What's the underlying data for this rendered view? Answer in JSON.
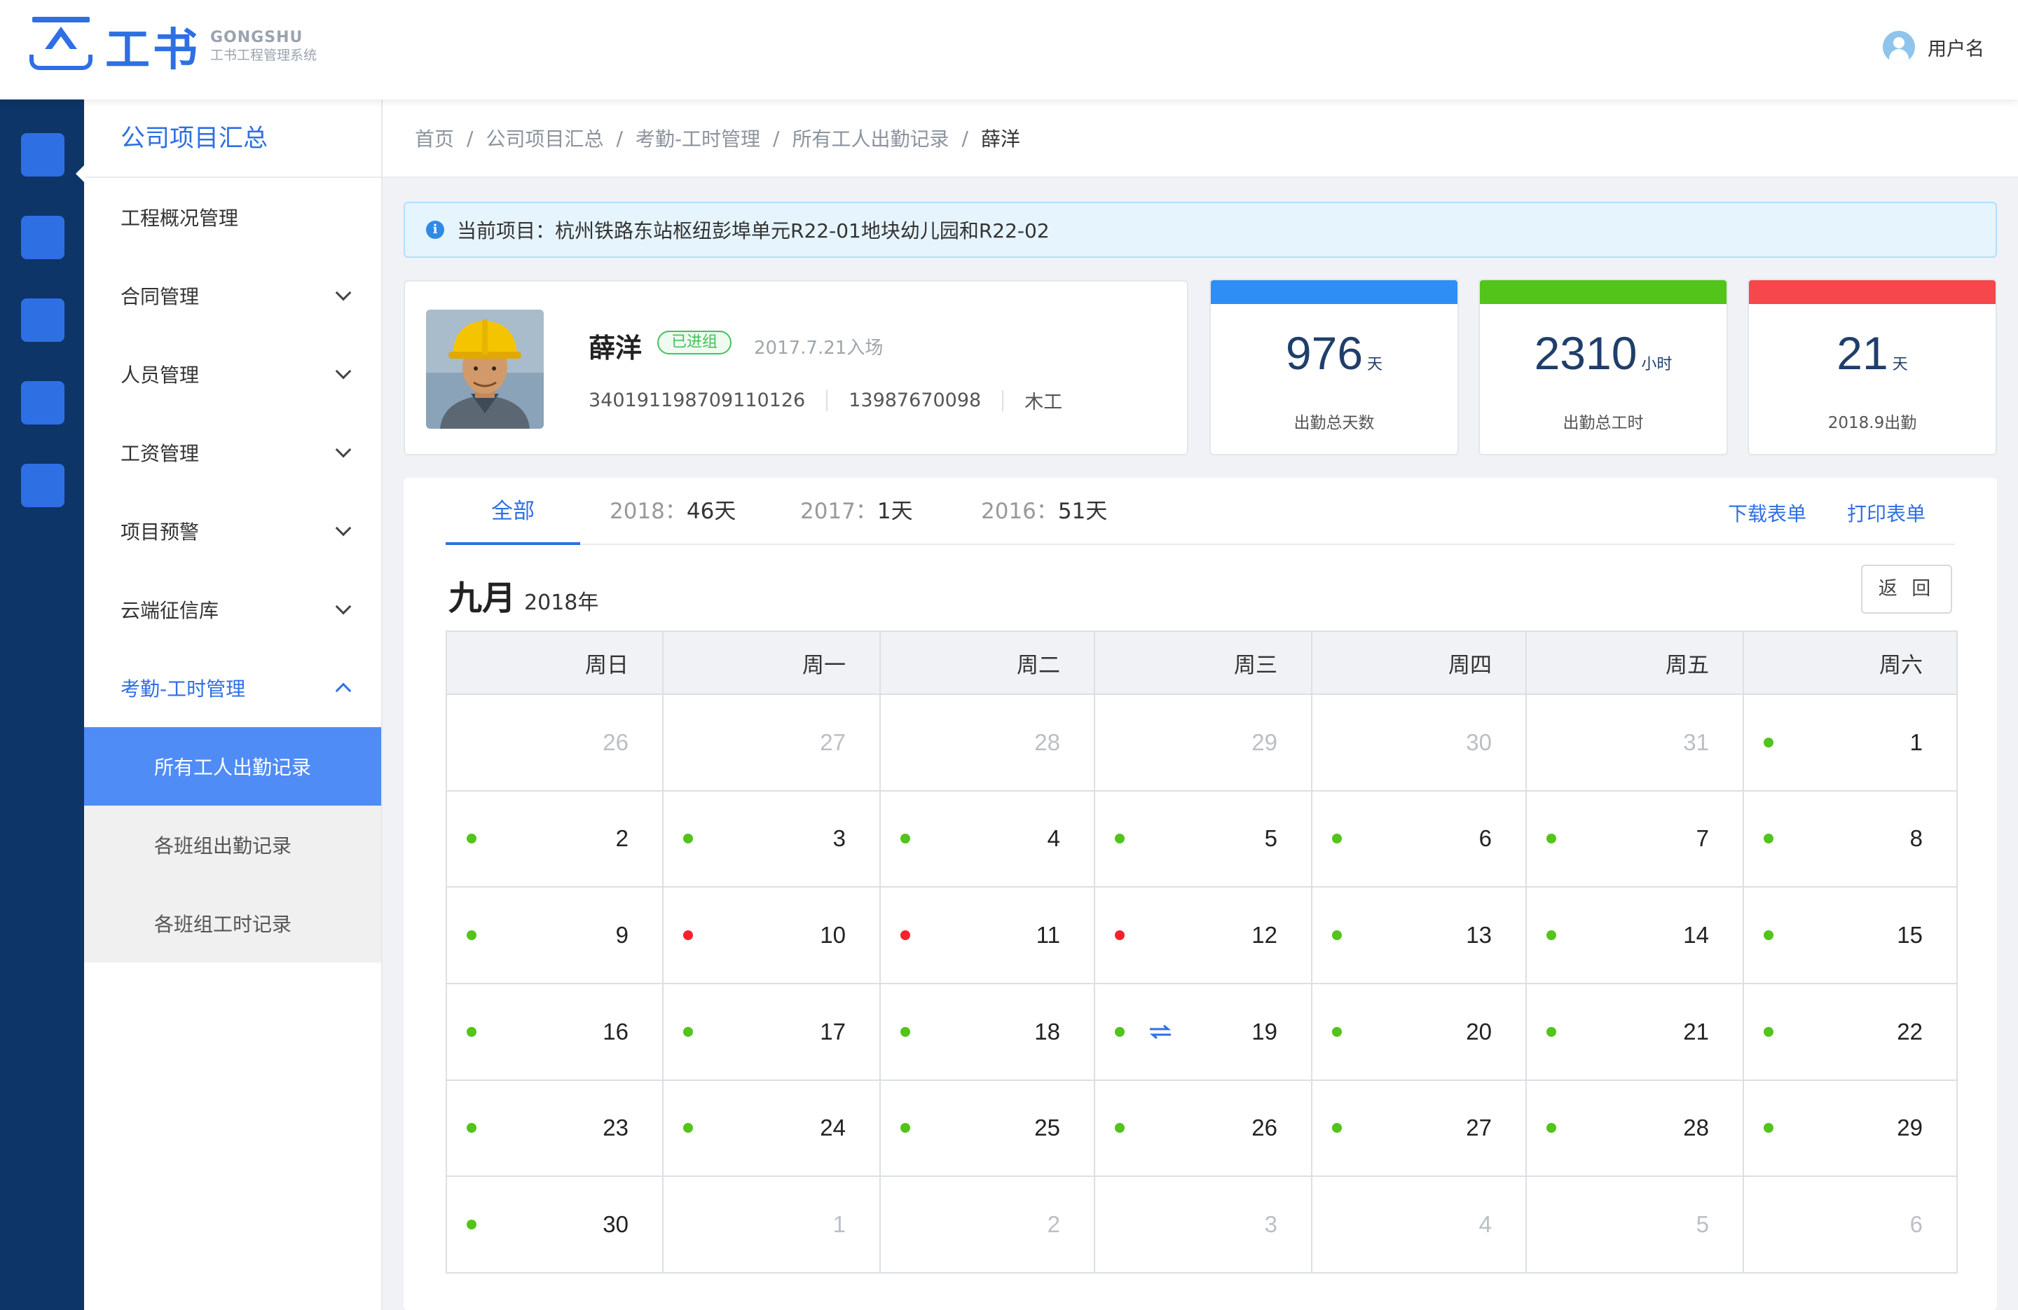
{
  "brand": {
    "logo_text": "工书",
    "logo_en": "GONGSHU",
    "logo_cn": "工书工程管理系统"
  },
  "user": {
    "name": "用户名"
  },
  "sidebar": {
    "title": "公司项目汇总",
    "items": [
      {
        "label": "工程概况管理"
      },
      {
        "label": "合同管理"
      },
      {
        "label": "人员管理"
      },
      {
        "label": "工资管理"
      },
      {
        "label": "项目预警"
      },
      {
        "label": "云端征信库"
      },
      {
        "label": "考勤-工时管理"
      }
    ],
    "sub_items": [
      {
        "label": "所有工人出勤记录"
      },
      {
        "label": "各班组出勤记录"
      },
      {
        "label": "各班组工时记录"
      }
    ]
  },
  "breadcrumb": [
    "首页",
    "公司项目汇总",
    "考勤-工时管理",
    "所有工人出勤记录",
    "薛洋"
  ],
  "alert": {
    "icon": "i",
    "text": "当前项目：杭州铁路东站枢纽彭埠单元R22-01地块幼儿园和R22-02"
  },
  "worker": {
    "name": "薛洋",
    "status": "已进组",
    "entry_date": "2017.7.21入场",
    "id_number": "340191198709110126",
    "phone": "13987670098",
    "trade": "木工"
  },
  "stats": [
    {
      "value": "976",
      "unit": "天",
      "label": "出勤总天数",
      "color": "#2f8ef5"
    },
    {
      "value": "2310",
      "unit": "小时",
      "label": "出勤总工时",
      "color": "#52c41a"
    },
    {
      "value": "21",
      "unit": "天",
      "label": "2018.9出勤",
      "color": "#f5474c"
    }
  ],
  "tabs": [
    {
      "label": "全部",
      "year": "",
      "value": ""
    },
    {
      "label": "",
      "year": "2018：",
      "value": "46天"
    },
    {
      "label": "",
      "year": "2017：",
      "value": "1天"
    },
    {
      "label": "",
      "year": "2016：",
      "value": "51天"
    }
  ],
  "actions": {
    "download": "下载表单",
    "print": "打印表单"
  },
  "calendar": {
    "month": "九月",
    "year": "2018年",
    "back_label": "返 回",
    "weekdays": [
      "周日",
      "周一",
      "周二",
      "周三",
      "周四",
      "周五",
      "周六"
    ],
    "rows": [
      [
        {
          "d": "26",
          "other": true
        },
        {
          "d": "27",
          "other": true
        },
        {
          "d": "28",
          "other": true
        },
        {
          "d": "29",
          "other": true
        },
        {
          "d": "30",
          "other": true
        },
        {
          "d": "31",
          "other": true
        },
        {
          "d": "1",
          "dot": "green"
        }
      ],
      [
        {
          "d": "2",
          "dot": "green"
        },
        {
          "d": "3",
          "dot": "green"
        },
        {
          "d": "4",
          "dot": "green"
        },
        {
          "d": "5",
          "dot": "green"
        },
        {
          "d": "6",
          "dot": "green"
        },
        {
          "d": "7",
          "dot": "green"
        },
        {
          "d": "8",
          "dot": "green"
        }
      ],
      [
        {
          "d": "9",
          "dot": "green"
        },
        {
          "d": "10",
          "dot": "red"
        },
        {
          "d": "11",
          "dot": "red"
        },
        {
          "d": "12",
          "dot": "red"
        },
        {
          "d": "13",
          "dot": "green"
        },
        {
          "d": "14",
          "dot": "green"
        },
        {
          "d": "15",
          "dot": "green"
        }
      ],
      [
        {
          "d": "16",
          "dot": "green"
        },
        {
          "d": "17",
          "dot": "green"
        },
        {
          "d": "18",
          "dot": "green"
        },
        {
          "d": "19",
          "dot": "green",
          "swap": true
        },
        {
          "d": "20",
          "dot": "green"
        },
        {
          "d": "21",
          "dot": "green"
        },
        {
          "d": "22",
          "dot": "green"
        }
      ],
      [
        {
          "d": "23",
          "dot": "green"
        },
        {
          "d": "24",
          "dot": "green"
        },
        {
          "d": "25",
          "dot": "green"
        },
        {
          "d": "26",
          "dot": "green"
        },
        {
          "d": "27",
          "dot": "green"
        },
        {
          "d": "28",
          "dot": "green"
        },
        {
          "d": "29",
          "dot": "green"
        }
      ],
      [
        {
          "d": "30",
          "dot": "green"
        },
        {
          "d": "1",
          "other": true
        },
        {
          "d": "2",
          "other": true
        },
        {
          "d": "3",
          "other": true
        },
        {
          "d": "4",
          "other": true
        },
        {
          "d": "5",
          "other": true
        },
        {
          "d": "6",
          "other": true
        }
      ]
    ]
  },
  "colors": {
    "accent": "#2f6fe4",
    "present": "#52c41a",
    "absent": "#f5222d",
    "rail": "#0e3567"
  },
  "icons": {
    "swap": "swap-arrows-icon",
    "info": "info-icon",
    "chevron": "chevron-down-icon"
  }
}
